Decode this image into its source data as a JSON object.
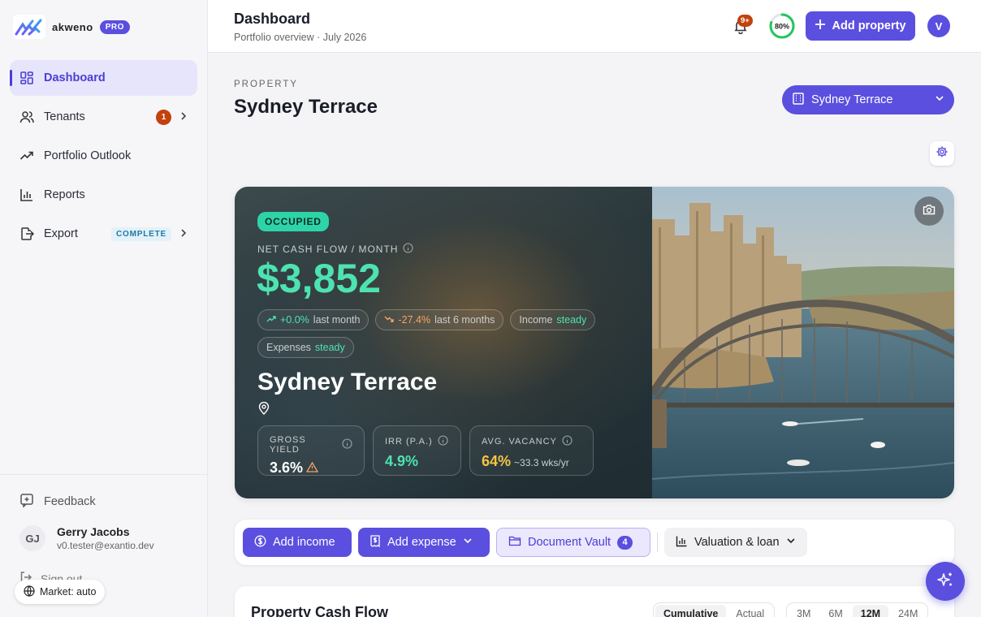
{
  "brand": {
    "name": "akweno",
    "plan": "PRO"
  },
  "sidebar": {
    "items": [
      {
        "label": "Dashboard",
        "icon": "grid-icon",
        "active": true
      },
      {
        "label": "Tenants",
        "icon": "users-icon",
        "badge": "1"
      },
      {
        "label": "Portfolio Outlook",
        "icon": "trending-up-icon"
      },
      {
        "label": "Reports",
        "icon": "bar-chart-icon"
      },
      {
        "label": "Export",
        "icon": "export-icon",
        "badge": "COMPLETE"
      }
    ],
    "feedback": "Feedback",
    "user": {
      "initials": "GJ",
      "name": "Gerry Jacobs",
      "email": "v0.tester@exantio.dev"
    },
    "signout": "Sign out",
    "market": "Market: auto"
  },
  "header": {
    "title": "Dashboard",
    "subtitle": "Portfolio overview · July 2026",
    "notifications": "9+",
    "progress": "80%",
    "progress_value": 0.8,
    "add_property": "Add property",
    "avatar": "V"
  },
  "property": {
    "label": "PROPERTY",
    "title": "Sydney Terrace",
    "selector": "Sydney Terrace"
  },
  "hero": {
    "status": "OCCUPIED",
    "ncf_label": "NET CASH FLOW / MONTH",
    "ncf_value": "$3,852",
    "chips": {
      "last_month_value": "+0.0%",
      "last_month_label": "last month",
      "six_month_value": "-27.4%",
      "six_month_label": "last 6 months",
      "income_label": "Income",
      "income_state": "steady",
      "expenses_label": "Expenses",
      "expenses_state": "steady"
    },
    "name": "Sydney Terrace",
    "metrics": {
      "gross_yield_label": "GROSS YIELD",
      "gross_yield_value": "3.6%",
      "irr_label": "IRR (P.A.)",
      "irr_value": "4.9%",
      "vacancy_label": "AVG. VACANCY",
      "vacancy_value": "64%",
      "vacancy_sub": "~33.3 wks/yr"
    }
  },
  "actions": {
    "add_income": "Add income",
    "add_expense": "Add expense",
    "document_vault": "Document Vault",
    "document_count": "4",
    "valuation": "Valuation & loan"
  },
  "cashflow": {
    "title": "Property Cash Flow",
    "modes": [
      "Cumulative",
      "Actual"
    ],
    "ranges": [
      "3M",
      "6M",
      "12M",
      "24M"
    ]
  },
  "colors": {
    "accent": "#5b4fe0",
    "teal": "#4de3b0",
    "amber": "#f4c542",
    "badge": "#c2410c"
  }
}
